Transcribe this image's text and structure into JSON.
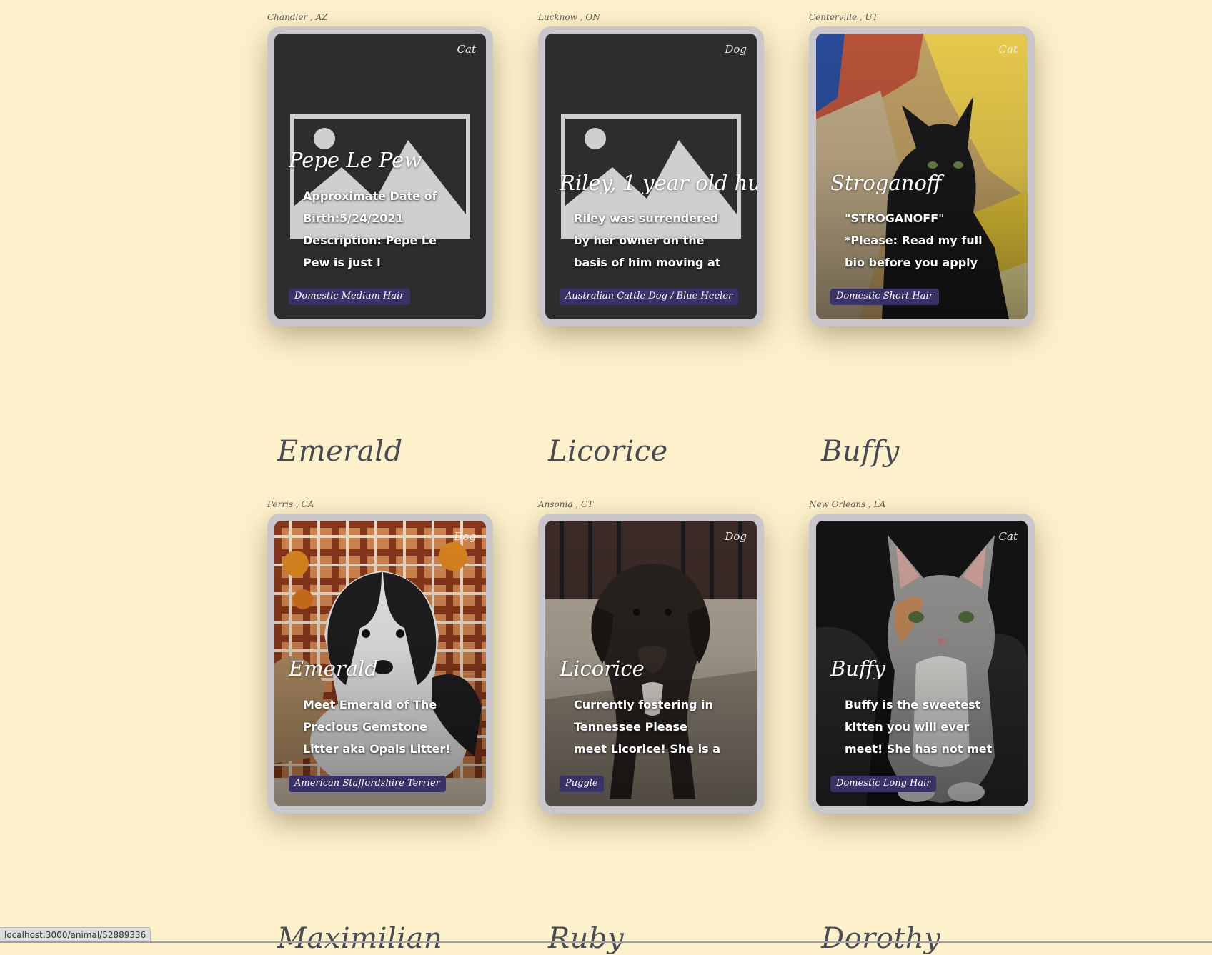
{
  "colors": {
    "page_background": "#fdf1cc",
    "card_frame": "#c9c7cb",
    "breed_badge": "#3a3166",
    "placeholder_background": "#2d2d2f"
  },
  "row_titles": [
    "Emerald",
    "Licorice",
    "Buffy",
    "Maximilian",
    "Ruby",
    "Dorothy"
  ],
  "cards": [
    {
      "location": "Chandler , AZ",
      "species": "Cat",
      "name": "Pepe Le Pew",
      "description": "Approximate Date of Birth:5/24/2021 Description: Pepe Le Pew is just l",
      "breed": "Domestic Medium Hair",
      "image": "placeholder-image-icon"
    },
    {
      "location": "Lucknow , ON",
      "species": "Dog",
      "name": "Riley, 1 year old hu",
      "description": "Riley was surrendered by her owner on the basis of him moving at month e",
      "breed": "Australian Cattle Dog / Blue Heeler",
      "image": "placeholder-image-icon"
    },
    {
      "location": "Centerville , UT",
      "species": "Cat",
      "name": "Stroganoff",
      "description": "\"STROGANOFF\" *Please: Read my full bio before you apply to make sure I",
      "breed": "Domestic Short Hair",
      "image": "black-cat-photo"
    },
    {
      "location": "Perris , CA",
      "species": "Dog",
      "name": "Emerald",
      "description": "Meet Emerald of The Precious Gemstone Litter aka Opals Litter! These pre",
      "breed": "American Staffordshire Terrier",
      "image": "black-white-puppy-photo"
    },
    {
      "location": "Ansonia , CT",
      "species": "Dog",
      "name": "Licorice",
      "description": "Currently fostering in Tennessee Please meet Licorice! She is a Puggle",
      "breed": "Puggle",
      "image": "brindle-dog-photo"
    },
    {
      "location": "New Orleans , LA",
      "species": "Cat",
      "name": "Buffy",
      "description": "Buffy is the sweetest kitten you will ever meet! She has not met a person",
      "breed": "Domestic Long Hair",
      "image": "gray-kitten-photo"
    }
  ],
  "status_bar": {
    "url": "localhost:3000/animal/52889336"
  }
}
